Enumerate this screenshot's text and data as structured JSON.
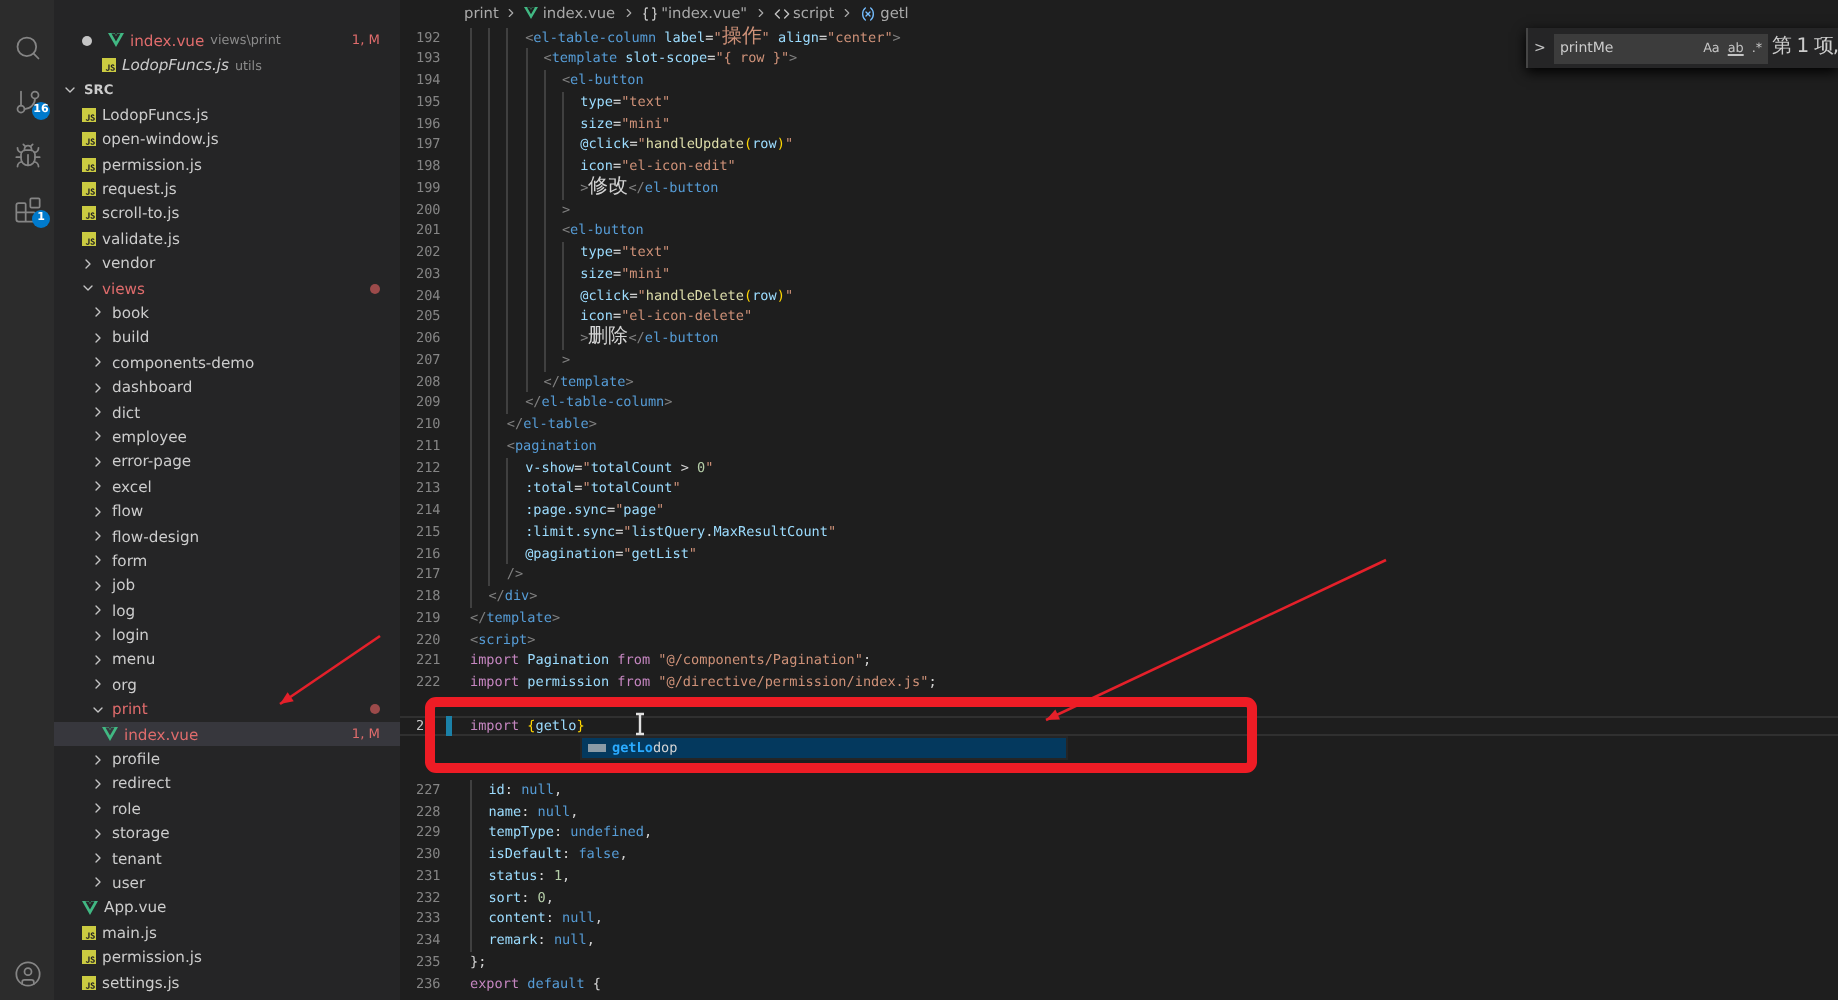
{
  "activity_bar": {
    "items": [
      {
        "kind": "search"
      },
      {
        "kind": "source-control",
        "badge": "16"
      },
      {
        "kind": "run"
      },
      {
        "kind": "extensions",
        "badge": "1"
      }
    ],
    "account": {
      "kind": "account"
    }
  },
  "sidebar": {
    "open_editors": [
      {
        "name": "index.vue",
        "path": "views\\print",
        "badge": "1, M",
        "kind": "vue",
        "modified": true,
        "unsaved": true,
        "preview": false
      },
      {
        "name": "LodopFuncs.js",
        "path": "utils",
        "kind": "js",
        "modified": false,
        "unsaved": false,
        "preview": true
      }
    ],
    "folder": {
      "label": "SRC",
      "expanded": true,
      "children": [
        {
          "kind": "js-file",
          "label": "LodopFuncs.js",
          "modified": false,
          "selected": false
        },
        {
          "kind": "js-file",
          "label": "open-window.js",
          "modified": false,
          "selected": false
        },
        {
          "kind": "js-file",
          "label": "permission.js",
          "modified": false,
          "selected": false
        },
        {
          "kind": "js-file",
          "label": "request.js",
          "modified": false,
          "selected": false
        },
        {
          "kind": "js-file",
          "label": "scroll-to.js",
          "modified": false,
          "selected": false
        },
        {
          "kind": "js-file",
          "label": "validate.js",
          "modified": false,
          "selected": false
        },
        {
          "kind": "folder",
          "label": "vendor",
          "expanded": false,
          "modified": false,
          "selected": false
        },
        {
          "kind": "folder",
          "label": "views",
          "expanded": true,
          "modified": true,
          "selected": false,
          "children": [
            {
              "kind": "folder",
              "label": "book",
              "expanded": false,
              "modified": false,
              "selected": false
            },
            {
              "kind": "folder",
              "label": "build",
              "expanded": false,
              "modified": false,
              "selected": false
            },
            {
              "kind": "folder",
              "label": "components-demo",
              "expanded": false,
              "modified": false,
              "selected": false
            },
            {
              "kind": "folder",
              "label": "dashboard",
              "expanded": false,
              "modified": false,
              "selected": false
            },
            {
              "kind": "folder",
              "label": "dict",
              "expanded": false,
              "modified": false,
              "selected": false
            },
            {
              "kind": "folder",
              "label": "employee",
              "expanded": false,
              "modified": false,
              "selected": false
            },
            {
              "kind": "folder",
              "label": "error-page",
              "expanded": false,
              "modified": false,
              "selected": false
            },
            {
              "kind": "folder",
              "label": "excel",
              "expanded": false,
              "modified": false,
              "selected": false
            },
            {
              "kind": "folder",
              "label": "flow",
              "expanded": false,
              "modified": false,
              "selected": false
            },
            {
              "kind": "folder",
              "label": "flow-design",
              "expanded": false,
              "modified": false,
              "selected": false
            },
            {
              "kind": "folder",
              "label": "form",
              "expanded": false,
              "modified": false,
              "selected": false
            },
            {
              "kind": "folder",
              "label": "job",
              "expanded": false,
              "modified": false,
              "selected": false
            },
            {
              "kind": "folder",
              "label": "log",
              "expanded": false,
              "modified": false,
              "selected": false
            },
            {
              "kind": "folder",
              "label": "login",
              "expanded": false,
              "modified": false,
              "selected": false
            },
            {
              "kind": "folder",
              "label": "menu",
              "expanded": false,
              "modified": false,
              "selected": false
            },
            {
              "kind": "folder",
              "label": "org",
              "expanded": false,
              "modified": false,
              "selected": false
            },
            {
              "kind": "folder",
              "label": "print",
              "expanded": true,
              "modified": true,
              "selected": false,
              "children": [
                {
                  "kind": "vue-file",
                  "label": "index.vue",
                  "modified": true,
                  "badge": "1, M",
                  "selected": true
                }
              ]
            },
            {
              "kind": "folder",
              "label": "profile",
              "expanded": false,
              "modified": false,
              "selected": false
            },
            {
              "kind": "folder",
              "label": "redirect",
              "expanded": false,
              "modified": false,
              "selected": false
            },
            {
              "kind": "folder",
              "label": "role",
              "expanded": false,
              "modified": false,
              "selected": false
            },
            {
              "kind": "folder",
              "label": "storage",
              "expanded": false,
              "modified": false,
              "selected": false
            },
            {
              "kind": "folder",
              "label": "tenant",
              "expanded": false,
              "modified": false,
              "selected": false
            },
            {
              "kind": "folder",
              "label": "user",
              "expanded": false,
              "modified": false,
              "selected": false
            }
          ]
        },
        {
          "kind": "vue-file",
          "label": "App.vue",
          "modified": false,
          "selected": false
        },
        {
          "kind": "js-file",
          "label": "main.js",
          "modified": false,
          "selected": false
        },
        {
          "kind": "js-file",
          "label": "permission.js",
          "modified": false,
          "selected": false
        },
        {
          "kind": "js-file",
          "label": "settings.js",
          "modified": false,
          "selected": false
        }
      ]
    }
  },
  "breadcrumbs": [
    {
      "kind": "folder",
      "label": "print"
    },
    {
      "kind": "vue",
      "label": "index.vue"
    },
    {
      "kind": "module",
      "label": "\"index.vue\""
    },
    {
      "kind": "script",
      "label": "script"
    },
    {
      "kind": "variable",
      "label": "getl"
    }
  ],
  "find_widget": {
    "toggle": ">",
    "value": "printMe",
    "options": [
      {
        "kind": "case",
        "label": "Aa"
      },
      {
        "kind": "word",
        "label": "ab"
      },
      {
        "kind": "regex",
        "label": ".*"
      }
    ],
    "result": "第 1 项,"
  },
  "editor": {
    "lines": [
      {
        "kind": "code",
        "number": "192",
        "current": false,
        "tokens": [
          {
            "kind": "punct",
            "text": "      <"
          },
          {
            "kind": "tag",
            "text": "el-table-column"
          },
          {
            "kind": "attr",
            "text": " label"
          },
          {
            "kind": "op",
            "text": "="
          },
          {
            "kind": "str",
            "text": "\"操作\""
          },
          {
            "kind": "attr",
            "text": " align"
          },
          {
            "kind": "op",
            "text": "="
          },
          {
            "kind": "str",
            "text": "\"center\""
          },
          {
            "kind": "punct",
            "text": ">"
          }
        ]
      },
      {
        "kind": "code",
        "number": "193",
        "current": false,
        "tokens": [
          {
            "kind": "punct",
            "text": "        <"
          },
          {
            "kind": "tag",
            "text": "template"
          },
          {
            "kind": "attr",
            "text": " slot-scope"
          },
          {
            "kind": "op",
            "text": "="
          },
          {
            "kind": "str",
            "text": "\"{ row }\""
          },
          {
            "kind": "punct",
            "text": ">"
          }
        ]
      },
      {
        "kind": "code",
        "number": "194",
        "current": false,
        "tokens": [
          {
            "kind": "punct",
            "text": "          <"
          },
          {
            "kind": "tag",
            "text": "el-button"
          }
        ]
      },
      {
        "kind": "code",
        "number": "195",
        "current": false,
        "tokens": [
          {
            "kind": "attr",
            "text": "            type"
          },
          {
            "kind": "op",
            "text": "="
          },
          {
            "kind": "str",
            "text": "\"text\""
          }
        ]
      },
      {
        "kind": "code",
        "number": "196",
        "current": false,
        "tokens": [
          {
            "kind": "attr",
            "text": "            size"
          },
          {
            "kind": "op",
            "text": "="
          },
          {
            "kind": "str",
            "text": "\"mini\""
          }
        ]
      },
      {
        "kind": "code",
        "number": "197",
        "current": false,
        "tokens": [
          {
            "kind": "attr",
            "text": "            @click"
          },
          {
            "kind": "op",
            "text": "="
          },
          {
            "kind": "str",
            "text": "\""
          },
          {
            "kind": "fn",
            "text": "handleUpdate"
          },
          {
            "kind": "brace",
            "text": "("
          },
          {
            "kind": "var",
            "text": "row"
          },
          {
            "kind": "brace",
            "text": ")"
          },
          {
            "kind": "str",
            "text": "\""
          }
        ]
      },
      {
        "kind": "code",
        "number": "198",
        "current": false,
        "tokens": [
          {
            "kind": "attr",
            "text": "            icon"
          },
          {
            "kind": "op",
            "text": "="
          },
          {
            "kind": "str",
            "text": "\"el-icon-edit\""
          }
        ]
      },
      {
        "kind": "code",
        "number": "199",
        "current": false,
        "tokens": [
          {
            "kind": "punct",
            "text": "            >"
          },
          {
            "kind": "text",
            "text": "修改"
          },
          {
            "kind": "punct",
            "text": "</"
          },
          {
            "kind": "tag",
            "text": "el-button"
          }
        ]
      },
      {
        "kind": "code",
        "number": "200",
        "current": false,
        "tokens": [
          {
            "kind": "punct",
            "text": "          >"
          }
        ]
      },
      {
        "kind": "code",
        "number": "201",
        "current": false,
        "tokens": [
          {
            "kind": "punct",
            "text": "          <"
          },
          {
            "kind": "tag",
            "text": "el-button"
          }
        ]
      },
      {
        "kind": "code",
        "number": "202",
        "current": false,
        "tokens": [
          {
            "kind": "attr",
            "text": "            type"
          },
          {
            "kind": "op",
            "text": "="
          },
          {
            "kind": "str",
            "text": "\"text\""
          }
        ]
      },
      {
        "kind": "code",
        "number": "203",
        "current": false,
        "tokens": [
          {
            "kind": "attr",
            "text": "            size"
          },
          {
            "kind": "op",
            "text": "="
          },
          {
            "kind": "str",
            "text": "\"mini\""
          }
        ]
      },
      {
        "kind": "code",
        "number": "204",
        "current": false,
        "tokens": [
          {
            "kind": "attr",
            "text": "            @click"
          },
          {
            "kind": "op",
            "text": "="
          },
          {
            "kind": "str",
            "text": "\""
          },
          {
            "kind": "fn",
            "text": "handleDelete"
          },
          {
            "kind": "brace",
            "text": "("
          },
          {
            "kind": "var",
            "text": "row"
          },
          {
            "kind": "brace",
            "text": ")"
          },
          {
            "kind": "str",
            "text": "\""
          }
        ]
      },
      {
        "kind": "code",
        "number": "205",
        "current": false,
        "tokens": [
          {
            "kind": "attr",
            "text": "            icon"
          },
          {
            "kind": "op",
            "text": "="
          },
          {
            "kind": "str",
            "text": "\"el-icon-delete\""
          }
        ]
      },
      {
        "kind": "code",
        "number": "206",
        "current": false,
        "tokens": [
          {
            "kind": "punct",
            "text": "            >"
          },
          {
            "kind": "text",
            "text": "删除"
          },
          {
            "kind": "punct",
            "text": "</"
          },
          {
            "kind": "tag",
            "text": "el-button"
          }
        ]
      },
      {
        "kind": "code",
        "number": "207",
        "current": false,
        "tokens": [
          {
            "kind": "punct",
            "text": "          >"
          }
        ]
      },
      {
        "kind": "code",
        "number": "208",
        "current": false,
        "tokens": [
          {
            "kind": "punct",
            "text": "        </"
          },
          {
            "kind": "tag",
            "text": "template"
          },
          {
            "kind": "punct",
            "text": ">"
          }
        ]
      },
      {
        "kind": "code",
        "number": "209",
        "current": false,
        "tokens": [
          {
            "kind": "punct",
            "text": "      </"
          },
          {
            "kind": "tag",
            "text": "el-table-column"
          },
          {
            "kind": "punct",
            "text": ">"
          }
        ]
      },
      {
        "kind": "code",
        "number": "210",
        "current": false,
        "tokens": [
          {
            "kind": "punct",
            "text": "    </"
          },
          {
            "kind": "tag",
            "text": "el-table"
          },
          {
            "kind": "punct",
            "text": ">"
          }
        ]
      },
      {
        "kind": "code",
        "number": "211",
        "current": false,
        "tokens": [
          {
            "kind": "punct",
            "text": "    <"
          },
          {
            "kind": "tag",
            "text": "pagination"
          }
        ]
      },
      {
        "kind": "code",
        "number": "212",
        "current": false,
        "tokens": [
          {
            "kind": "attr",
            "text": "      v-show"
          },
          {
            "kind": "op",
            "text": "="
          },
          {
            "kind": "str",
            "text": "\""
          },
          {
            "kind": "var",
            "text": "totalCount"
          },
          {
            "kind": "op",
            "text": " > "
          },
          {
            "kind": "num",
            "text": "0"
          },
          {
            "kind": "str",
            "text": "\""
          }
        ]
      },
      {
        "kind": "code",
        "number": "213",
        "current": false,
        "tokens": [
          {
            "kind": "attr",
            "text": "      :total"
          },
          {
            "kind": "op",
            "text": "="
          },
          {
            "kind": "str",
            "text": "\""
          },
          {
            "kind": "var",
            "text": "totalCount"
          },
          {
            "kind": "str",
            "text": "\""
          }
        ]
      },
      {
        "kind": "code",
        "number": "214",
        "current": false,
        "tokens": [
          {
            "kind": "attr",
            "text": "      :page.sync"
          },
          {
            "kind": "op",
            "text": "="
          },
          {
            "kind": "str",
            "text": "\""
          },
          {
            "kind": "var",
            "text": "page"
          },
          {
            "kind": "str",
            "text": "\""
          }
        ]
      },
      {
        "kind": "code",
        "number": "215",
        "current": false,
        "tokens": [
          {
            "kind": "attr",
            "text": "      :limit.sync"
          },
          {
            "kind": "op",
            "text": "="
          },
          {
            "kind": "str",
            "text": "\""
          },
          {
            "kind": "var",
            "text": "listQuery"
          },
          {
            "kind": "op",
            "text": "."
          },
          {
            "kind": "var",
            "text": "MaxResultCount"
          },
          {
            "kind": "str",
            "text": "\""
          }
        ]
      },
      {
        "kind": "code",
        "number": "216",
        "current": false,
        "tokens": [
          {
            "kind": "attr",
            "text": "      @pagination"
          },
          {
            "kind": "op",
            "text": "="
          },
          {
            "kind": "str",
            "text": "\""
          },
          {
            "kind": "var",
            "text": "getList"
          },
          {
            "kind": "str",
            "text": "\""
          }
        ]
      },
      {
        "kind": "code",
        "number": "217",
        "current": false,
        "tokens": [
          {
            "kind": "punct",
            "text": "    />"
          }
        ]
      },
      {
        "kind": "code",
        "number": "218",
        "current": false,
        "tokens": [
          {
            "kind": "punct",
            "text": "  </"
          },
          {
            "kind": "tag",
            "text": "div"
          },
          {
            "kind": "punct",
            "text": ">"
          }
        ]
      },
      {
        "kind": "code",
        "number": "219",
        "current": false,
        "tokens": [
          {
            "kind": "punct",
            "text": "</"
          },
          {
            "kind": "tag",
            "text": "template"
          },
          {
            "kind": "punct",
            "text": ">"
          }
        ]
      },
      {
        "kind": "code",
        "number": "220",
        "current": false,
        "tokens": [
          {
            "kind": "punct",
            "text": "<"
          },
          {
            "kind": "tag",
            "text": "script"
          },
          {
            "kind": "punct",
            "text": ">"
          }
        ]
      },
      {
        "kind": "code",
        "number": "221",
        "current": false,
        "tokens": [
          {
            "kind": "kw",
            "text": "import"
          },
          {
            "kind": "var",
            "text": " Pagination"
          },
          {
            "kind": "kw",
            "text": " from"
          },
          {
            "kind": "str",
            "text": " \"@/components/Pagination\""
          },
          {
            "kind": "op",
            "text": ";"
          }
        ]
      },
      {
        "kind": "code",
        "number": "222",
        "current": false,
        "tokens": [
          {
            "kind": "kw",
            "text": "import"
          },
          {
            "kind": "var",
            "text": " permission"
          },
          {
            "kind": "kw",
            "text": " from"
          },
          {
            "kind": "str",
            "text": " \"@/directive/permission/index.js\""
          },
          {
            "kind": "op",
            "text": ";"
          }
        ]
      },
      {
        "kind": "covered"
      },
      {
        "kind": "code",
        "number": "2",
        "current": true,
        "tokens": [
          {
            "kind": "kw",
            "text": "import"
          },
          {
            "kind": "brace",
            "text": " {"
          },
          {
            "kind": "var",
            "text": "getlo"
          },
          {
            "kind": "brace",
            "text": "}"
          }
        ],
        "suggestion": {
          "match": "getLo",
          "rest": "dop"
        }
      },
      {
        "kind": "covered"
      },
      {
        "kind": "covered"
      },
      {
        "kind": "code",
        "number": "227",
        "current": false,
        "tokens": [
          {
            "kind": "var",
            "text": "  id"
          },
          {
            "kind": "op",
            "text": ": "
          },
          {
            "kind": "const",
            "text": "null"
          },
          {
            "kind": "op",
            "text": ","
          }
        ]
      },
      {
        "kind": "code",
        "number": "228",
        "current": false,
        "tokens": [
          {
            "kind": "var",
            "text": "  name"
          },
          {
            "kind": "op",
            "text": ": "
          },
          {
            "kind": "const",
            "text": "null"
          },
          {
            "kind": "op",
            "text": ","
          }
        ]
      },
      {
        "kind": "code",
        "number": "229",
        "current": false,
        "tokens": [
          {
            "kind": "var",
            "text": "  tempType"
          },
          {
            "kind": "op",
            "text": ": "
          },
          {
            "kind": "const",
            "text": "undefined"
          },
          {
            "kind": "op",
            "text": ","
          }
        ]
      },
      {
        "kind": "code",
        "number": "230",
        "current": false,
        "tokens": [
          {
            "kind": "var",
            "text": "  isDefault"
          },
          {
            "kind": "op",
            "text": ": "
          },
          {
            "kind": "const",
            "text": "false"
          },
          {
            "kind": "op",
            "text": ","
          }
        ]
      },
      {
        "kind": "code",
        "number": "231",
        "current": false,
        "tokens": [
          {
            "kind": "var",
            "text": "  status"
          },
          {
            "kind": "op",
            "text": ": "
          },
          {
            "kind": "num",
            "text": "1"
          },
          {
            "kind": "op",
            "text": ","
          }
        ]
      },
      {
        "kind": "code",
        "number": "232",
        "current": false,
        "tokens": [
          {
            "kind": "var",
            "text": "  sort"
          },
          {
            "kind": "op",
            "text": ": "
          },
          {
            "kind": "num",
            "text": "0"
          },
          {
            "kind": "op",
            "text": ","
          }
        ]
      },
      {
        "kind": "code",
        "number": "233",
        "current": false,
        "tokens": [
          {
            "kind": "var",
            "text": "  content"
          },
          {
            "kind": "op",
            "text": ": "
          },
          {
            "kind": "const",
            "text": "null"
          },
          {
            "kind": "op",
            "text": ","
          }
        ]
      },
      {
        "kind": "code",
        "number": "234",
        "current": false,
        "tokens": [
          {
            "kind": "var",
            "text": "  remark"
          },
          {
            "kind": "op",
            "text": ": "
          },
          {
            "kind": "const",
            "text": "null"
          },
          {
            "kind": "op",
            "text": ","
          }
        ]
      },
      {
        "kind": "code",
        "number": "235",
        "current": false,
        "tokens": [
          {
            "kind": "op",
            "text": "};"
          }
        ]
      },
      {
        "kind": "code",
        "number": "236",
        "current": false,
        "tokens": [
          {
            "kind": "kw",
            "text": "export"
          },
          {
            "kind": "const",
            "text": " default"
          },
          {
            "kind": "op",
            "text": " {"
          }
        ]
      }
    ]
  },
  "annotations": [
    {
      "kind": "arrow"
    },
    {
      "kind": "arrow"
    },
    {
      "kind": "frame"
    }
  ]
}
